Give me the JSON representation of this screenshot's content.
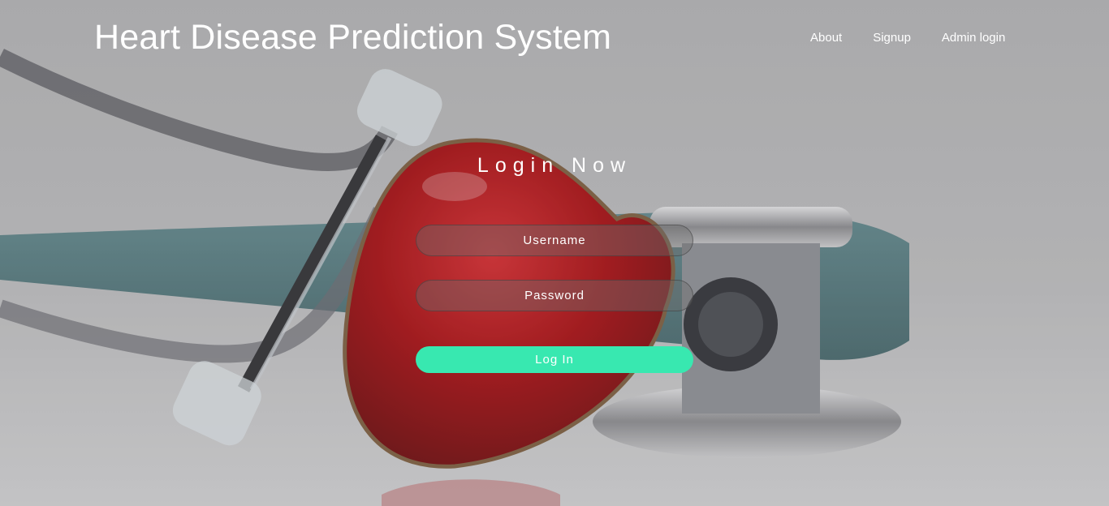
{
  "header": {
    "title": "Heart Disease Prediction System",
    "nav": [
      {
        "label": "About"
      },
      {
        "label": "Signup"
      },
      {
        "label": "Admin login"
      }
    ]
  },
  "login": {
    "title": "Login Now",
    "username_placeholder": "Username",
    "password_placeholder": "Password",
    "submit_label": "Log In"
  },
  "colors": {
    "accent": "#38e8b0",
    "heart": "#b0080c",
    "background": "#b4b4b6"
  },
  "background": {
    "image": "stethoscope-heart-photo"
  }
}
